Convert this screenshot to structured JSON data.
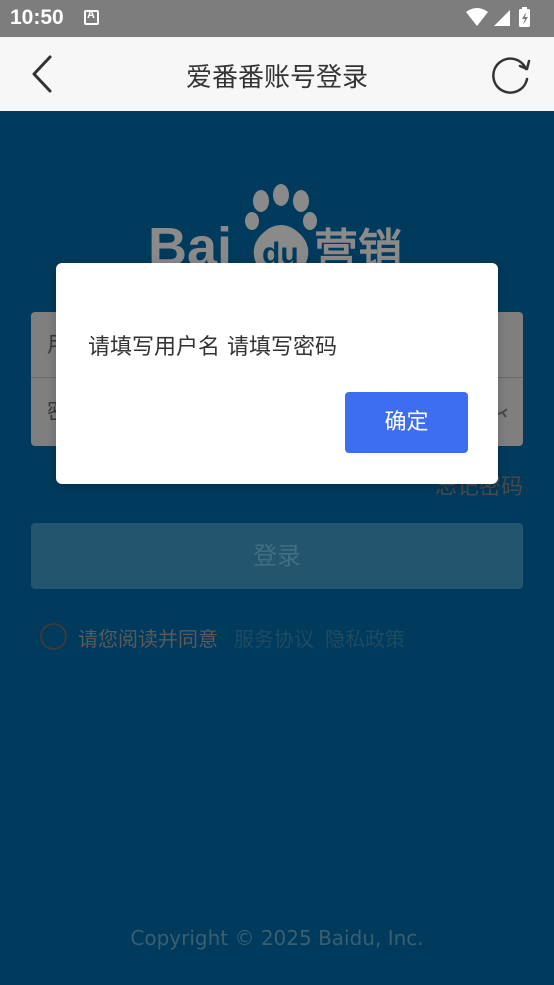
{
  "status_bar": {
    "time": "10:50",
    "icons": [
      "text-a-icon",
      "wifi-icon",
      "signal-icon",
      "battery-charging-icon"
    ]
  },
  "header": {
    "title": "爱番番账号登录",
    "icons": [
      "back-arrow-icon",
      "refresh-icon"
    ]
  },
  "logo": {
    "brand": "Baidu营销"
  },
  "form": {
    "username_placeholder": "用户名",
    "password_placeholder": "密码",
    "forgot_password": "忘记密码",
    "login_button": "登录",
    "agree_prefix": "请您阅读并同意",
    "service_link": "服务协议",
    "privacy_link": "隐私政策"
  },
  "footer": {
    "copyright": "Copyright © 2025 Baidu, Inc."
  },
  "dialog": {
    "message": "请填写用户名 请填写密码",
    "confirm": "确定"
  },
  "colors": {
    "page_bg": "#003a5c",
    "header_bg": "#f7f7f7",
    "status_bg": "#7d7d7d",
    "confirm_button": "#3d6ef2",
    "login_button": "#23566e"
  }
}
